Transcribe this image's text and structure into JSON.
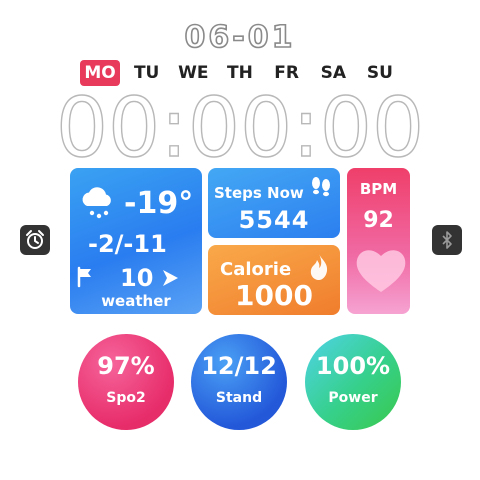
{
  "date": "06-01",
  "weekdays": [
    {
      "label": "MO",
      "active": true
    },
    {
      "label": "TU",
      "active": false
    },
    {
      "label": "WE",
      "active": false
    },
    {
      "label": "TH",
      "active": false
    },
    {
      "label": "FR",
      "active": false
    },
    {
      "label": "SA",
      "active": false
    },
    {
      "label": "SU",
      "active": false
    }
  ],
  "time": "00:00:00",
  "weather": {
    "temperature": "-19°",
    "range": "-2/-11",
    "wind": "10",
    "label": "weather",
    "icon": "cloud-rain-icon"
  },
  "steps": {
    "label": "Steps Now",
    "value": "5544",
    "icon": "footprints-icon"
  },
  "calorie": {
    "label": "Calorie",
    "value": "1000",
    "icon": "flame-icon"
  },
  "bpm": {
    "label": "BPM",
    "value": "92",
    "icon": "heart-icon"
  },
  "spo2": {
    "value": "97%",
    "label": "Spo2"
  },
  "stand": {
    "value": "12/12",
    "label": "Stand"
  },
  "power": {
    "value": "100%",
    "label": "Power"
  },
  "colors": {
    "accent_red": "#e83a5a",
    "weather_blue": "#2a7df0",
    "calorie_orange": "#f07d2c",
    "bpm_pink": "#ef3f6a",
    "spo2": "#e72c6a",
    "stand": "#2358d9",
    "power": "#39c84b"
  }
}
